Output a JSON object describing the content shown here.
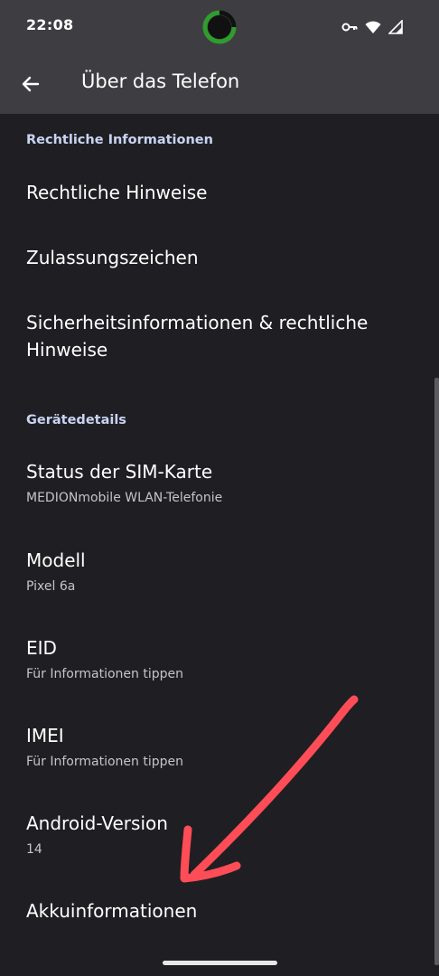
{
  "status_bar": {
    "time": "22:08",
    "icons": [
      "vpn-key-icon",
      "wifi-icon",
      "signal-icon"
    ],
    "battery_ring_color": "#2e9d2e"
  },
  "app_bar": {
    "back_icon": "arrow-left-icon",
    "title": "Über das Telefon"
  },
  "sections": {
    "legal_header": "Rechtliche Informationen",
    "legal_items": [
      {
        "title": "Rechtliche Hinweise"
      },
      {
        "title": "Zulassungszeichen"
      },
      {
        "title_line1": "Sicherheitsinformationen & rechtliche",
        "title_line2": "Hinweise"
      }
    ],
    "device_header": "Gerätedetails",
    "device_items": [
      {
        "title": "Status der SIM-Karte",
        "subtitle": "MEDIONmobile WLAN-Telefonie"
      },
      {
        "title": "Modell",
        "subtitle": "Pixel 6a"
      },
      {
        "title": "EID",
        "subtitle": "Für Informationen tippen"
      },
      {
        "title": "IMEI",
        "subtitle": "Für Informationen tippen"
      },
      {
        "title": "Android-Version",
        "subtitle": "14"
      },
      {
        "title": "Akkuinformationen"
      }
    ]
  },
  "colors": {
    "background": "#1f1f23",
    "app_bar": "#3e3e42",
    "section_header": "#c9d4f2",
    "annotation_arrow": "#ff4d57"
  }
}
